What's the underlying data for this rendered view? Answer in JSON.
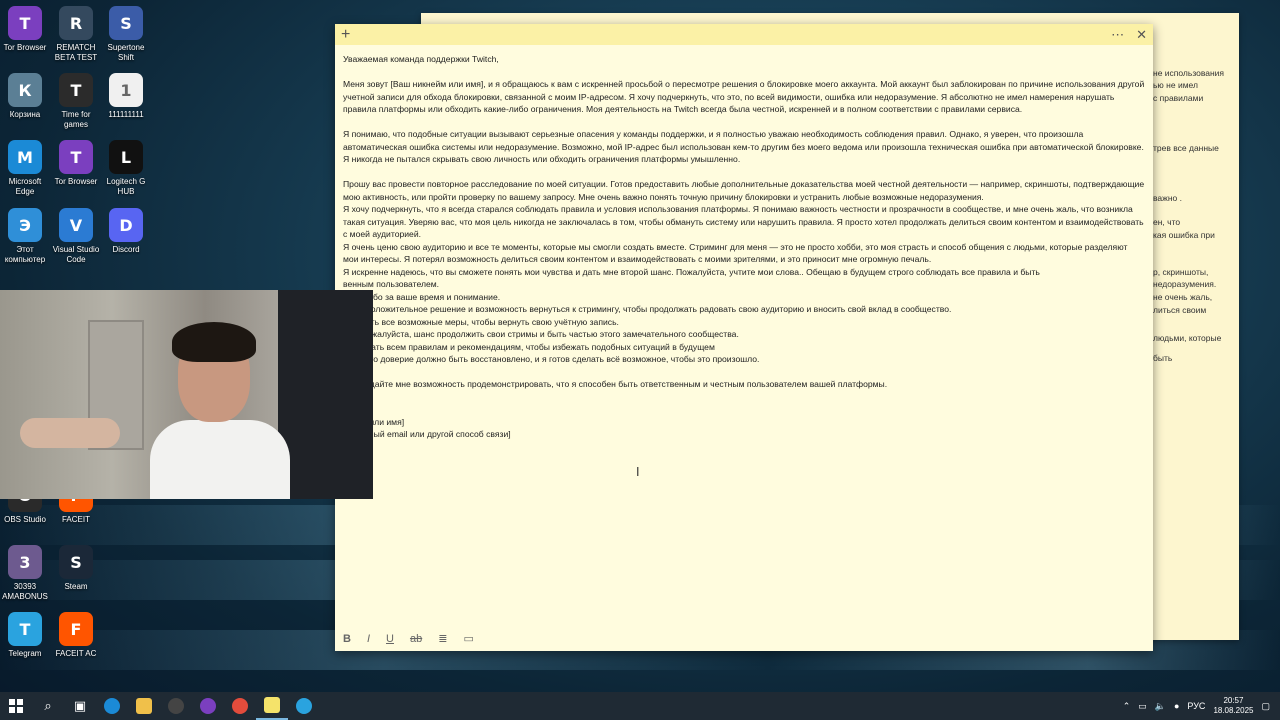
{
  "desktop": {
    "icons": [
      {
        "label": "Tor Browser",
        "icon": "tor-browser-icon",
        "color": "#7b3fbf"
      },
      {
        "label": "REMATCH\nBETA TEST",
        "icon": "rematch-icon",
        "color": "#34495e"
      },
      {
        "label": "Supertone\nShift",
        "icon": "supertone-icon",
        "color": "#3b5ca8"
      },
      {
        "label": "Корзина",
        "icon": "recycle-bin-icon",
        "color": "#5b7f95"
      },
      {
        "label": "Time for\ngames",
        "icon": "time-for-games-icon",
        "color": "#2b2b2b"
      },
      {
        "label": "111111111",
        "icon": "file-icon",
        "color": "#f0f0f0"
      },
      {
        "label": "Microsoft\nEdge",
        "icon": "edge-icon",
        "color": "#1b8ad6"
      },
      {
        "label": "Tor Browser",
        "icon": "tor-browser-icon",
        "color": "#7b3fbf"
      },
      {
        "label": "Logitech G\nHUB",
        "icon": "logitech-icon",
        "color": "#111111"
      },
      {
        "label": "Этот\nкомпьютер",
        "icon": "computer-icon",
        "color": "#2f8fd8"
      },
      {
        "label": "Visual Studio\nCode",
        "icon": "vscode-icon",
        "color": "#2b7bd3"
      },
      {
        "label": "Discord",
        "icon": "discord-icon",
        "color": "#5865f2"
      },
      {
        "label": "OBS Studio",
        "icon": "obs-icon",
        "color": "#2a2a2a"
      },
      {
        "label": "FACEIT",
        "icon": "faceit-icon",
        "color": "#ff5500"
      },
      {
        "label": "30393\nAMABONUS",
        "icon": "amabonus-icon",
        "color": "#6d5a8f"
      },
      {
        "label": "Steam",
        "icon": "steam-icon",
        "color": "#1b2838"
      },
      {
        "label": "Telegram",
        "icon": "telegram-icon",
        "color": "#2aa3df"
      },
      {
        "label": "FACEIT AC",
        "icon": "faceit-ac-icon",
        "color": "#ff5500"
      }
    ]
  },
  "back_note": {
    "peek_lines": [
      "не использования",
      "ью не имел",
      "с правилами",
      "трев все данные",
      "важно .",
      "ен, что",
      "кая ошибка при",
      "р, скриншоты,",
      "недоразумения.",
      "не очень жаль,",
      "литься своим",
      "людьми, которые",
      "быть"
    ]
  },
  "note": {
    "greeting": "Уважаемая команда поддержки Twitch,",
    "paragraphs": [
      "Меня зовут [Ваш никнейм или имя], и я обращаюсь к вам с искренней просьбой о пересмотре решения о блокировке моего аккаунта. Мой аккаунт был заблокирован по причине использования другой учетной записи для обхода блокировки, связанной с моим IP-адресом. Я хочу подчеркнуть, что это, по всей видимости, ошибка или недоразумение. Я абсолютно не имел намерения нарушать правила платформы или обходить какие-либо ограничения. Моя деятельность на Twitch всегда была честной, искренней и в полном соответствии с правилами сервиса.",
      "Я понимаю, что подобные ситуации вызывают серьезные опасения у команды поддержки, и я полностью уважаю необходимость соблюдения правил. Однако, я уверен, что произошла автоматическая ошибка системы или недоразумение. Возможно, мой IP-адрес был использован кем-то другим без моего ведома или произошла техническая ошибка при автоматической блокировке. Я никогда не пытался скрывать свою личность или обходить ограничения платформы умышленно.",
      "Прошу вас провести повторное расследование по моей ситуации. Готов предоставить любые дополнительные доказательства моей честной деятельности — например, скриншоты, подтверждающие мою активность, или пройти проверку по вашему запросу. Мне очень важно понять точную причину блокировки и устранить любые возможные недоразумения.\nЯ хочу подчеркнуть, что я всегда старался соблюдать правила и условия использования платформы. Я понимаю важность честности и прозрачности в сообществе, и мне очень жаль, что возникла такая ситуация. Уверяю вас, что моя цель никогда не заключалась в том, чтобы обмануть систему или нарушить правила. Я просто хотел продолжать делиться своим контентом и взаимодействовать с моей аудиторией.\nЯ очень ценю свою аудиторию и все те моменты, которые мы смогли создать вместе. Стриминг для меня — это не просто хобби, это моя страсть и способ общения с людьми, которые разделяют мои интересы. Я потерял возможность делиться своим контентом и взаимодействовать с моими зрителями, и это приносит мне огромную печаль.\nЯ искренне надеюсь, что вы сможете понять мои чувства и дать мне второй шанс. Пожалуйста, учтите мои слова.. Обещаю в будущем строго соблюдать все правила и быть\nвенным пользователем.\nе спасибо за ваше время и понимание.\nсь на положительное решение и возможность вернуться к стримингу, чтобы продолжать радовать свою аудиторию и вносить свой вклад в сообщество.\nобсудить все возможные меры, чтобы вернуть свою учётную запись.\nине, пожалуйста, шанс продолжить свои стримы и быть частью этого замечательного сообщества.\nследовать всем правилам и рекомендациям, чтобы избежать подобных ситуаций в будущем\nмаю, что доверие должно быть восстановлено, и я готов сделать всё возможное, чтобы это произошло.",
      "уйста, дайте мне возможность продемонстрировать, что я способен быть ответственным и честным пользователем вашей платформы.",
      "ением,\nкнейм или имя]\nонтактный email или другой способ связи]"
    ],
    "toolbar": {
      "bold": "B",
      "italic": "I",
      "underline": "U",
      "strike": "ab",
      "list": "≣",
      "image": "▭"
    }
  },
  "taskbar": {
    "language": "РУС",
    "time": "20:57",
    "date": "18.08.2025"
  }
}
